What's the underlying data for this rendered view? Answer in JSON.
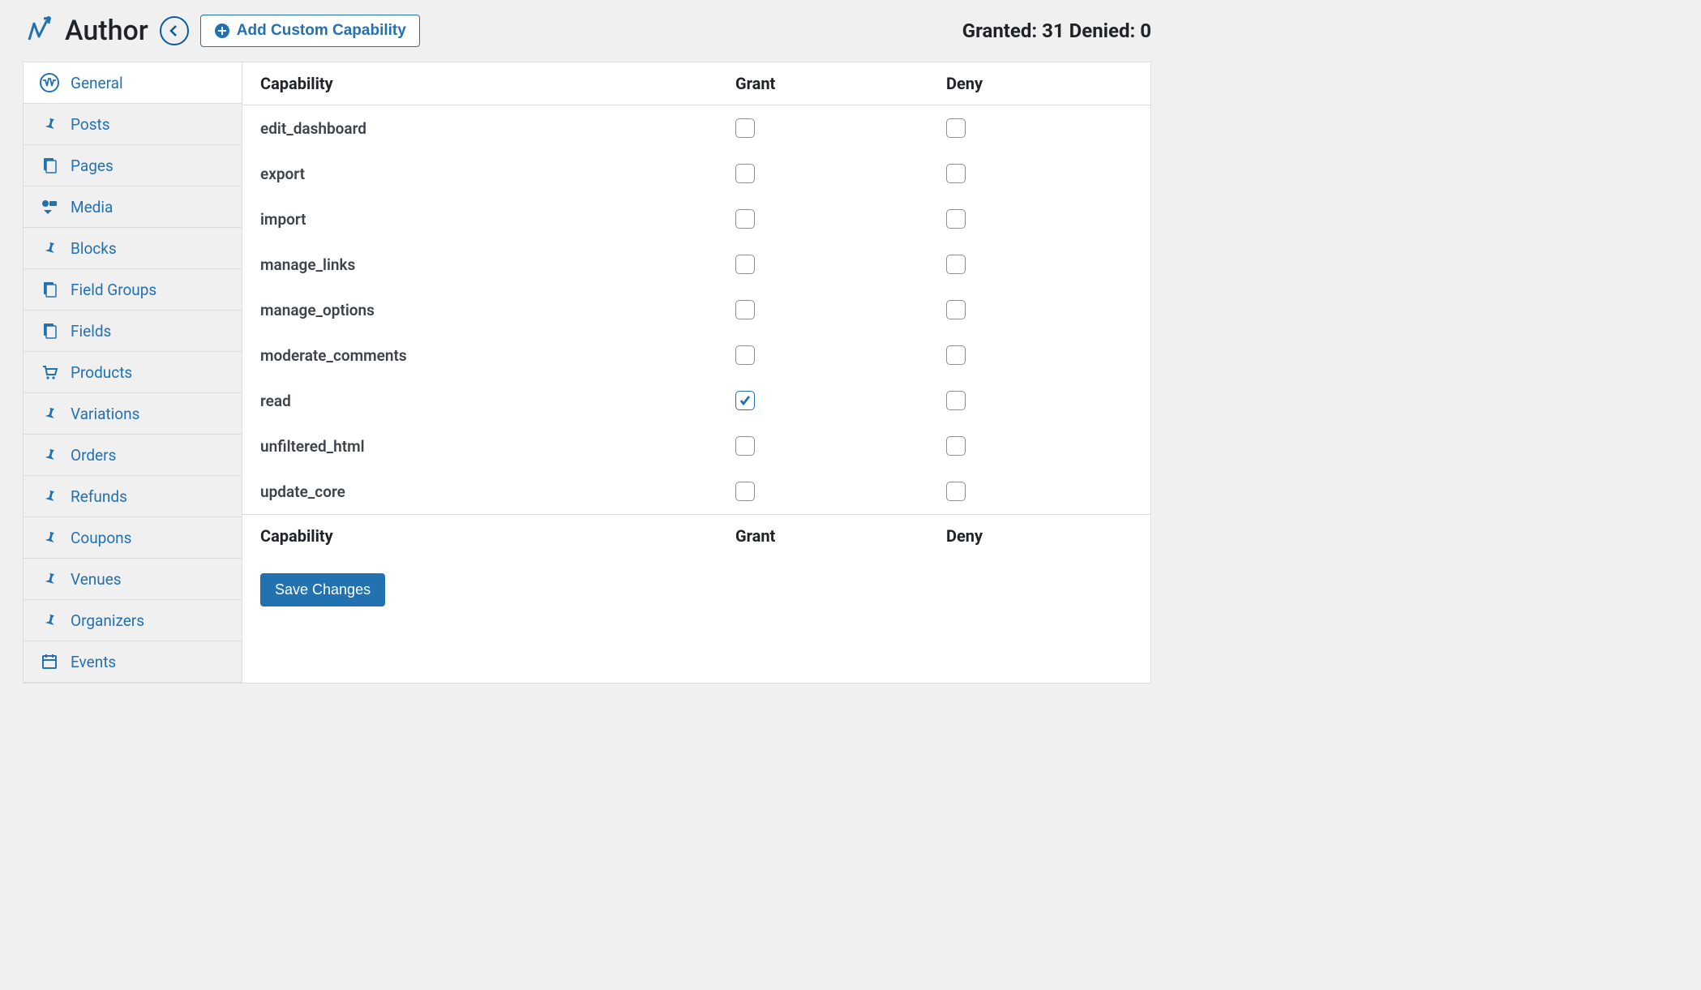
{
  "header": {
    "title": "Author",
    "add_button": "Add Custom Capability",
    "granted_label": "Granted:",
    "granted_count": "31",
    "denied_label": "Denied:",
    "denied_count": "0"
  },
  "sidebar": {
    "items": [
      {
        "label": "General",
        "icon": "wordpress",
        "active": true
      },
      {
        "label": "Posts",
        "icon": "pin",
        "active": false
      },
      {
        "label": "Pages",
        "icon": "pages",
        "active": false
      },
      {
        "label": "Media",
        "icon": "media",
        "active": false
      },
      {
        "label": "Blocks",
        "icon": "pin",
        "active": false
      },
      {
        "label": "Field Groups",
        "icon": "pages",
        "active": false
      },
      {
        "label": "Fields",
        "icon": "pages",
        "active": false
      },
      {
        "label": "Products",
        "icon": "cart",
        "active": false
      },
      {
        "label": "Variations",
        "icon": "pin",
        "active": false
      },
      {
        "label": "Orders",
        "icon": "pin",
        "active": false
      },
      {
        "label": "Refunds",
        "icon": "pin",
        "active": false
      },
      {
        "label": "Coupons",
        "icon": "pin",
        "active": false
      },
      {
        "label": "Venues",
        "icon": "pin",
        "active": false
      },
      {
        "label": "Organizers",
        "icon": "pin",
        "active": false
      },
      {
        "label": "Events",
        "icon": "calendar",
        "active": false
      }
    ]
  },
  "table": {
    "col_capability": "Capability",
    "col_grant": "Grant",
    "col_deny": "Deny",
    "rows": [
      {
        "name": "edit_dashboard",
        "grant": false,
        "deny": false
      },
      {
        "name": "export",
        "grant": false,
        "deny": false
      },
      {
        "name": "import",
        "grant": false,
        "deny": false
      },
      {
        "name": "manage_links",
        "grant": false,
        "deny": false
      },
      {
        "name": "manage_options",
        "grant": false,
        "deny": false
      },
      {
        "name": "moderate_comments",
        "grant": false,
        "deny": false
      },
      {
        "name": "read",
        "grant": true,
        "deny": false
      },
      {
        "name": "unfiltered_html",
        "grant": false,
        "deny": false
      },
      {
        "name": "update_core",
        "grant": false,
        "deny": false
      }
    ]
  },
  "actions": {
    "save": "Save Changes"
  }
}
